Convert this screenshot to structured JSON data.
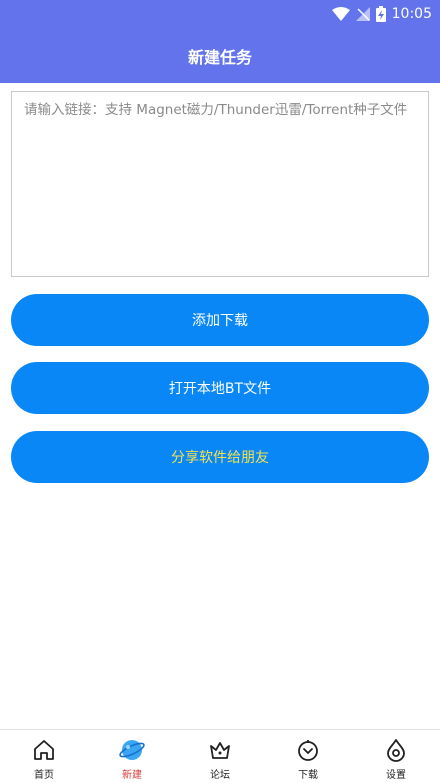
{
  "statusbar": {
    "time": "10:05"
  },
  "header": {
    "title": "新建任务"
  },
  "input": {
    "value": "",
    "placeholder": "请输入链接：支持 Magnet磁力/Thunder迅雷/Torrent种子文件"
  },
  "buttons": {
    "add": "添加下载",
    "open_bt": "打开本地BT文件",
    "share": "分享软件给朋友"
  },
  "tabs": [
    {
      "label": "首页",
      "icon": "home-icon"
    },
    {
      "label": "新建",
      "icon": "planet-icon",
      "active": true
    },
    {
      "label": "论坛",
      "icon": "crown-icon"
    },
    {
      "label": "下载",
      "icon": "download-face-icon"
    },
    {
      "label": "设置",
      "icon": "settings-drop-icon"
    }
  ],
  "colors": {
    "header": "#6273ec",
    "button": "#0a87f7",
    "share_text": "#f3e24a",
    "active_tab": "#d63a3a"
  }
}
